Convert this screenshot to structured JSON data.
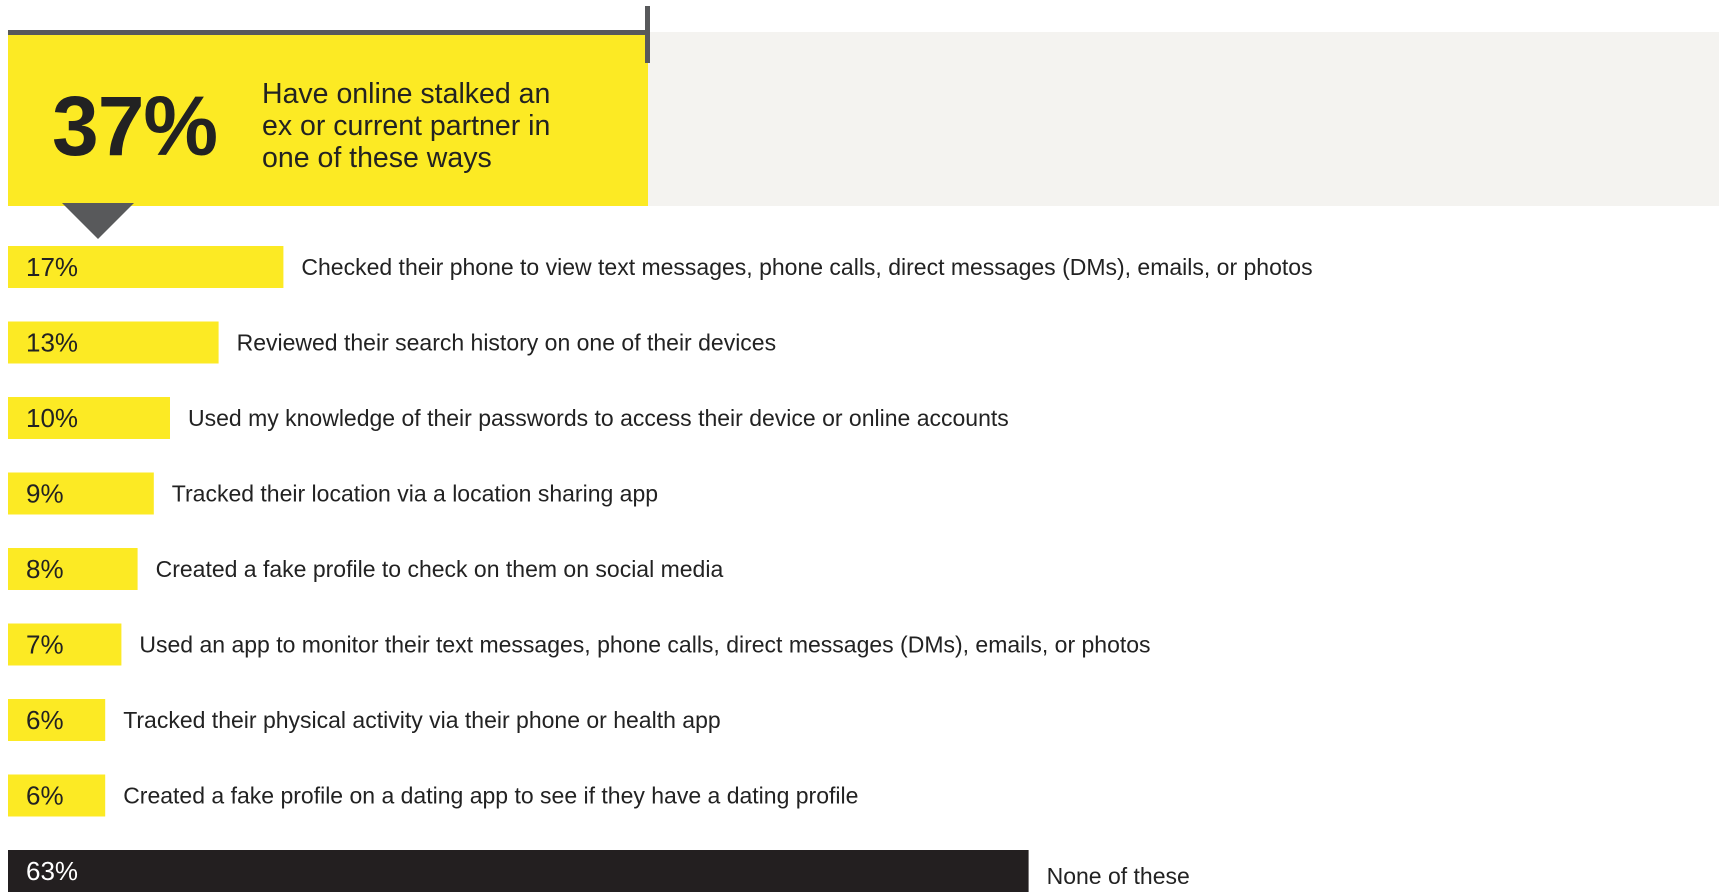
{
  "header": {
    "stat": "37%",
    "text_lines": [
      "Have online stalked an",
      "ex or current partner in",
      "one of these ways"
    ]
  },
  "colors": {
    "accent": "#fcea24",
    "dark_bar": "#231f20",
    "rule": "#58595b",
    "header_bg": "#f4f3f0"
  },
  "chart_data": {
    "type": "bar",
    "orientation": "horizontal",
    "categories": [
      "Checked their phone to view text messages, phone calls, direct messages (DMs), emails, or photos",
      "Reviewed their search history on one of their devices",
      "Used my knowledge of their passwords to access their device or online accounts",
      "Tracked their location via a location sharing app",
      "Created a fake profile to check on them on social media",
      "Used an app to monitor their text messages, phone calls, direct messages (DMs), emails, or photos",
      "Tracked their physical activity via their phone or health app",
      "Created a fake profile on a dating app to see if they have a dating profile",
      "None of these"
    ],
    "values": [
      17,
      13,
      10,
      9,
      8,
      7,
      6,
      6,
      63
    ],
    "value_labels": [
      "17%",
      "13%",
      "10%",
      "9%",
      "8%",
      "7%",
      "6%",
      "6%",
      "63%"
    ],
    "highlight": [
      false,
      false,
      false,
      false,
      false,
      false,
      false,
      false,
      true
    ],
    "unit": "%"
  }
}
